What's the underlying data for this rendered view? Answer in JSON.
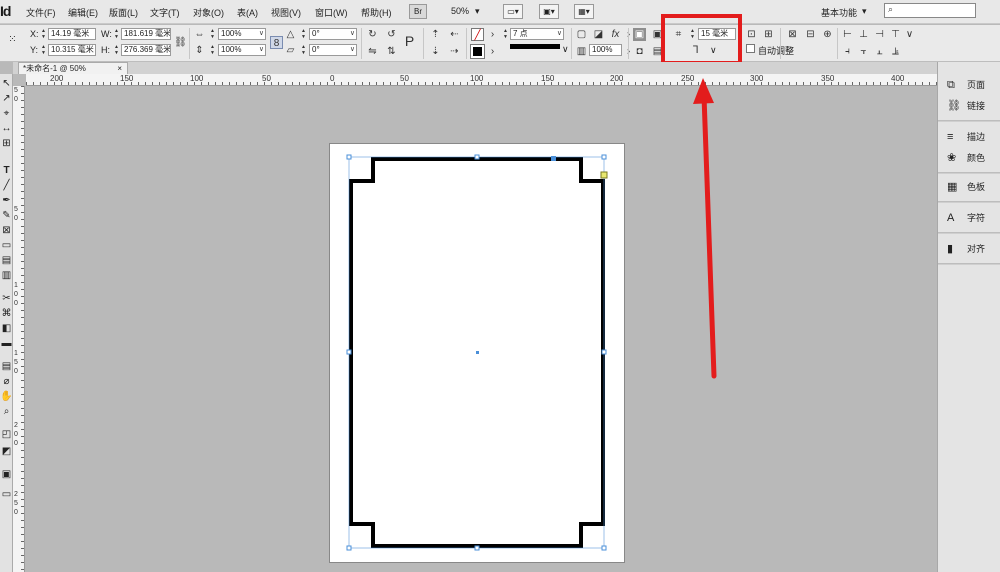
{
  "app": {
    "id_text": "Id"
  },
  "menu": {
    "items": [
      "文件(F)",
      "编辑(E)",
      "版面(L)",
      "文字(T)",
      "对象(O)",
      "表(A)",
      "视图(V)",
      "窗口(W)",
      "帮助(H)"
    ],
    "bridge_label": "Br",
    "zoom": "50%",
    "workspace": "基本功能",
    "workspace_arrow": "▾"
  },
  "control": {
    "x_label": "X:",
    "x_value": "14.19 毫米",
    "y_label": "Y:",
    "y_value": "10.315 毫米",
    "w_label": "W:",
    "w_value": "181.619 毫米",
    "h_label": "H:",
    "h_value": "276.369 毫米",
    "scale_x": "100%",
    "scale_y": "100%",
    "rotate": "0°",
    "shear": "0°",
    "stroke_weight": "7 点",
    "opacity": "100%",
    "corner_size": "15 毫米",
    "auto_fit_label": "自动调整"
  },
  "tab": {
    "title": "*未命名-1 @ 50%",
    "close": "×"
  },
  "ruler": {
    "h_labels": [
      "200",
      "150",
      "100",
      "50",
      "0",
      "50",
      "100",
      "150",
      "200",
      "250",
      "300",
      "350",
      "400"
    ],
    "v_labels": [
      "5",
      "0",
      "5",
      "0",
      "1",
      "0",
      "0",
      "1",
      "5",
      "0",
      "2",
      "0",
      "0",
      "2",
      "5",
      "0"
    ]
  },
  "panels": {
    "items": [
      {
        "icon": "pages-icon",
        "label": "页面"
      },
      {
        "icon": "links-icon",
        "label": "链接"
      },
      {
        "icon": "stroke-icon",
        "label": "描边"
      },
      {
        "icon": "color-icon",
        "label": "颜色"
      },
      {
        "icon": "swatches-icon",
        "label": "色板"
      },
      {
        "icon": "character-icon",
        "label": "字符"
      },
      {
        "icon": "align-icon",
        "label": "对齐"
      }
    ]
  },
  "colors": {
    "highlight": "#e31c1c",
    "arrow": "#e31c1c",
    "frame": "#000000",
    "handle": "#4a8fd8"
  }
}
